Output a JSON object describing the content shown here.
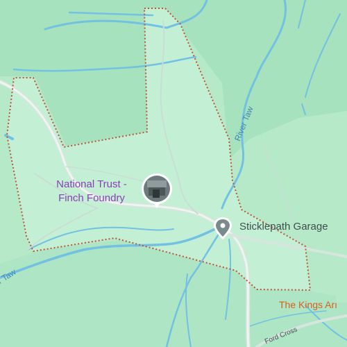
{
  "map": {
    "place_label_line1": "National Trust -",
    "place_label_line2": "Finch Foundry",
    "garage_label": "Sticklepath Garage",
    "pub_label": "The Kings Arı",
    "river_label_1": "River Taw",
    "river_label_2": "r Taw",
    "road_label": "Ford Cross",
    "icons": [
      "photo-pin-icon",
      "location-pin-icon"
    ]
  },
  "colors": {
    "land": "#b6e9c8",
    "forest": "#9ddfb7",
    "park": "#c2f0d4",
    "water": "#6fc0e6",
    "road": "#d7e6df",
    "boundary": "#c0523a",
    "place_text": "#8a3fb5",
    "pub_text": "#d9601c"
  }
}
